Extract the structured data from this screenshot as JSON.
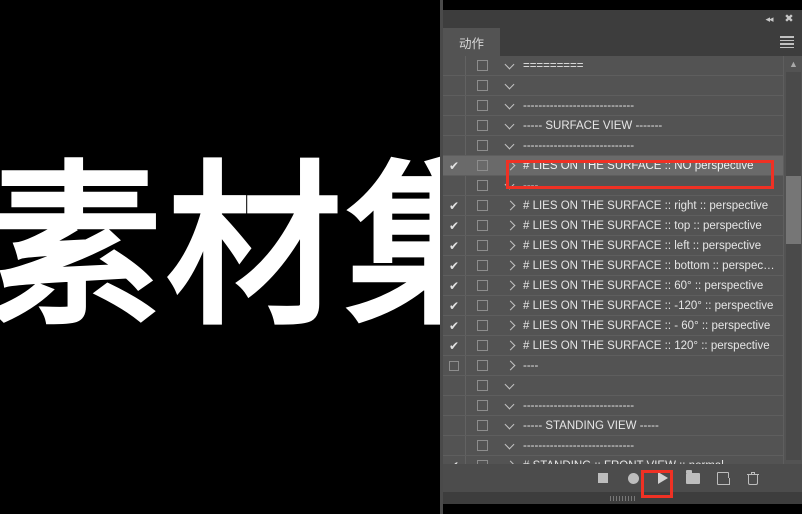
{
  "background": {
    "artwork_text": "素材集"
  },
  "panel": {
    "tab_label": "动作",
    "titlebar": {
      "collapse_icon": "collapse-double-left-icon",
      "close_icon": "close-icon",
      "menu_icon": "hamburger-menu-icon"
    },
    "rows": [
      {
        "checked": false,
        "show_checkbox": false,
        "box": true,
        "arrow": "down",
        "label": "=========",
        "selected": false
      },
      {
        "checked": false,
        "show_checkbox": false,
        "box": true,
        "arrow": "down",
        "label": "",
        "selected": false
      },
      {
        "checked": false,
        "show_checkbox": false,
        "box": true,
        "arrow": "down",
        "label": "-----------------------------",
        "selected": false
      },
      {
        "checked": false,
        "show_checkbox": false,
        "box": true,
        "arrow": "down",
        "label": "----- SURFACE VIEW -------",
        "selected": false
      },
      {
        "checked": false,
        "show_checkbox": false,
        "box": true,
        "arrow": "down",
        "label": "-----------------------------",
        "selected": false
      },
      {
        "checked": true,
        "show_checkbox": false,
        "box": true,
        "arrow": "right",
        "label": "# LIES ON THE SURFACE :: NO perspective",
        "selected": true
      },
      {
        "checked": false,
        "show_checkbox": false,
        "box": true,
        "arrow": "down",
        "label": "----",
        "selected": false
      },
      {
        "checked": true,
        "show_checkbox": false,
        "box": true,
        "arrow": "right",
        "label": "# LIES ON THE SURFACE :: right :: perspective",
        "selected": false
      },
      {
        "checked": true,
        "show_checkbox": false,
        "box": true,
        "arrow": "right",
        "label": "# LIES ON THE SURFACE :: top :: perspective",
        "selected": false
      },
      {
        "checked": true,
        "show_checkbox": false,
        "box": true,
        "arrow": "right",
        "label": "# LIES ON THE SURFACE :: left :: perspective",
        "selected": false
      },
      {
        "checked": true,
        "show_checkbox": false,
        "box": true,
        "arrow": "right",
        "label": "# LIES ON THE SURFACE :: bottom :: perspec…",
        "selected": false
      },
      {
        "checked": true,
        "show_checkbox": false,
        "box": true,
        "arrow": "right",
        "label": "# LIES ON THE SURFACE :: 60° :: perspective",
        "selected": false
      },
      {
        "checked": true,
        "show_checkbox": false,
        "box": true,
        "arrow": "right",
        "label": "# LIES ON THE SURFACE :: -120° :: perspective",
        "selected": false
      },
      {
        "checked": true,
        "show_checkbox": false,
        "box": true,
        "arrow": "right",
        "label": "# LIES ON THE SURFACE :: - 60° :: perspective",
        "selected": false
      },
      {
        "checked": true,
        "show_checkbox": false,
        "box": true,
        "arrow": "right",
        "label": "# LIES ON THE SURFACE :: 120° :: perspective",
        "selected": false
      },
      {
        "checked": false,
        "show_checkbox": true,
        "box": true,
        "arrow": "right",
        "label": "----",
        "selected": false
      },
      {
        "checked": false,
        "show_checkbox": false,
        "box": true,
        "arrow": "down",
        "label": "",
        "selected": false
      },
      {
        "checked": false,
        "show_checkbox": false,
        "box": true,
        "arrow": "down",
        "label": "-----------------------------",
        "selected": false
      },
      {
        "checked": false,
        "show_checkbox": false,
        "box": true,
        "arrow": "down",
        "label": "----- STANDING VIEW -----",
        "selected": false
      },
      {
        "checked": false,
        "show_checkbox": false,
        "box": true,
        "arrow": "down",
        "label": "-----------------------------",
        "selected": false
      },
      {
        "checked": true,
        "show_checkbox": false,
        "box": true,
        "arrow": "right",
        "label": "# STANDING :: FRONT VIEW :: normal",
        "selected": false
      }
    ],
    "scrollbar": {
      "up_icon": "chevron-up-icon",
      "down_icon": "chevron-down-icon"
    },
    "toolbar": {
      "stop_icon": "stop-icon",
      "record_icon": "record-icon",
      "play_icon": "play-icon",
      "folder_icon": "new-set-folder-icon",
      "new_action_icon": "new-action-icon",
      "delete_icon": "delete-trash-icon"
    }
  },
  "colors": {
    "panel_bg": "#535353",
    "titlebar_bg": "#3d3d3d",
    "row_selected": "#6a6a6a",
    "highlight_red": "#ef3124",
    "text": "#e6e6e6"
  }
}
